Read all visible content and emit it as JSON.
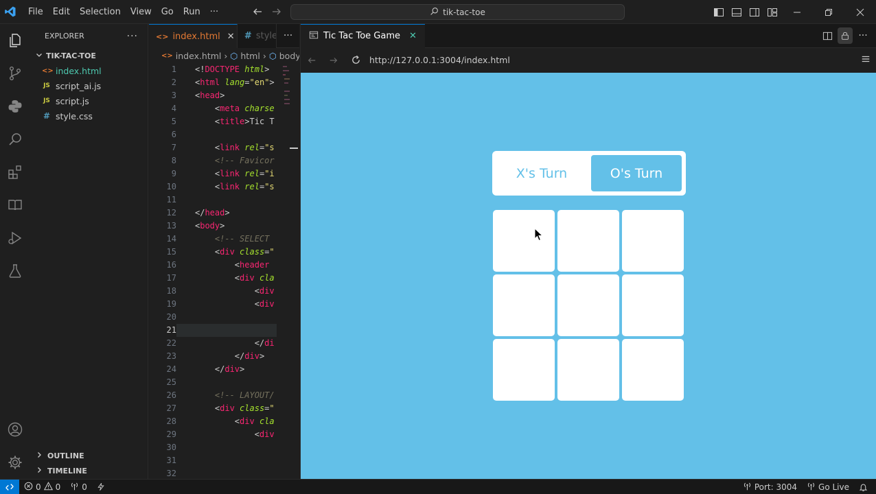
{
  "titlebar": {
    "menu": [
      "File",
      "Edit",
      "Selection",
      "View",
      "Go",
      "Run",
      "···"
    ],
    "search": "tik-tac-toe"
  },
  "sidebar": {
    "title": "EXPLORER",
    "folder": "TIK-TAC-TOE",
    "files": [
      {
        "name": "index.html",
        "icon": "<>",
        "color": "#e37933"
      },
      {
        "name": "script_ai.js",
        "icon": "JS",
        "color": "#cbcb41"
      },
      {
        "name": "script.js",
        "icon": "JS",
        "color": "#cbcb41"
      },
      {
        "name": "style.css",
        "icon": "#",
        "color": "#519aba"
      }
    ],
    "outline": "OUTLINE",
    "timeline": "TIMELINE"
  },
  "editor": {
    "tabs": [
      {
        "label": "index.html",
        "close": "✕"
      },
      {
        "label": "style."
      }
    ],
    "breadcrumb": [
      "index.html",
      "html",
      "body"
    ],
    "current_line": 21
  },
  "browser": {
    "tab_title": "Tic Tac Toe Game",
    "url": "http://127.0.0.1:3004/index.html",
    "game": {
      "x_turn": "X's Turn",
      "o_turn": "O's Turn",
      "active": "O"
    }
  },
  "status": {
    "errors": "0",
    "warnings": "0",
    "ports": "0",
    "port": "Port: 3004",
    "go_live": "Go Live"
  },
  "colors": {
    "accent": "#0078d4",
    "game_bg": "#63c0e8"
  }
}
